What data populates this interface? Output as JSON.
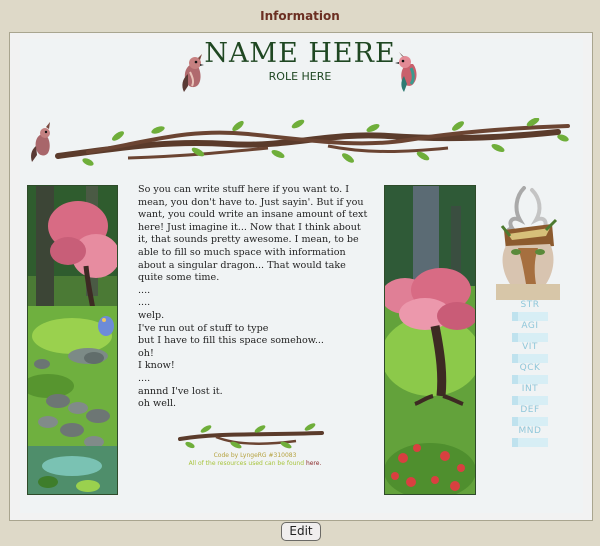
{
  "window": {
    "title": "Information"
  },
  "header": {
    "name": "NAME HERE",
    "role": "ROLE HERE"
  },
  "body": {
    "lines": [
      "So you can write stuff here if you want to. I mean, you don't have to. Just sayin'. But if you want, you could write an insane amount of text here! Just imagine it... Now that I think about it, that sounds pretty awesome. I mean, to be able to fill so much space with information about a singular dragon... That would take quite some time.",
      "....",
      "....",
      "welp.",
      "I've run out of stuff to type",
      "but I have to fill this space somehow...",
      "oh!",
      "I know!",
      "....",
      "annnd I've lost it.",
      "oh well."
    ]
  },
  "credits": {
    "code": "Code by LyngeRG #310083",
    "resources_prefix": "All of the resources used can be found ",
    "resources_link": "here."
  },
  "stats": [
    {
      "label": "STR"
    },
    {
      "label": "AGI"
    },
    {
      "label": "VIT"
    },
    {
      "label": "QCK"
    },
    {
      "label": "INT"
    },
    {
      "label": "DEF"
    },
    {
      "label": "MND"
    }
  ],
  "footer": {
    "edit_label": "Edit"
  }
}
